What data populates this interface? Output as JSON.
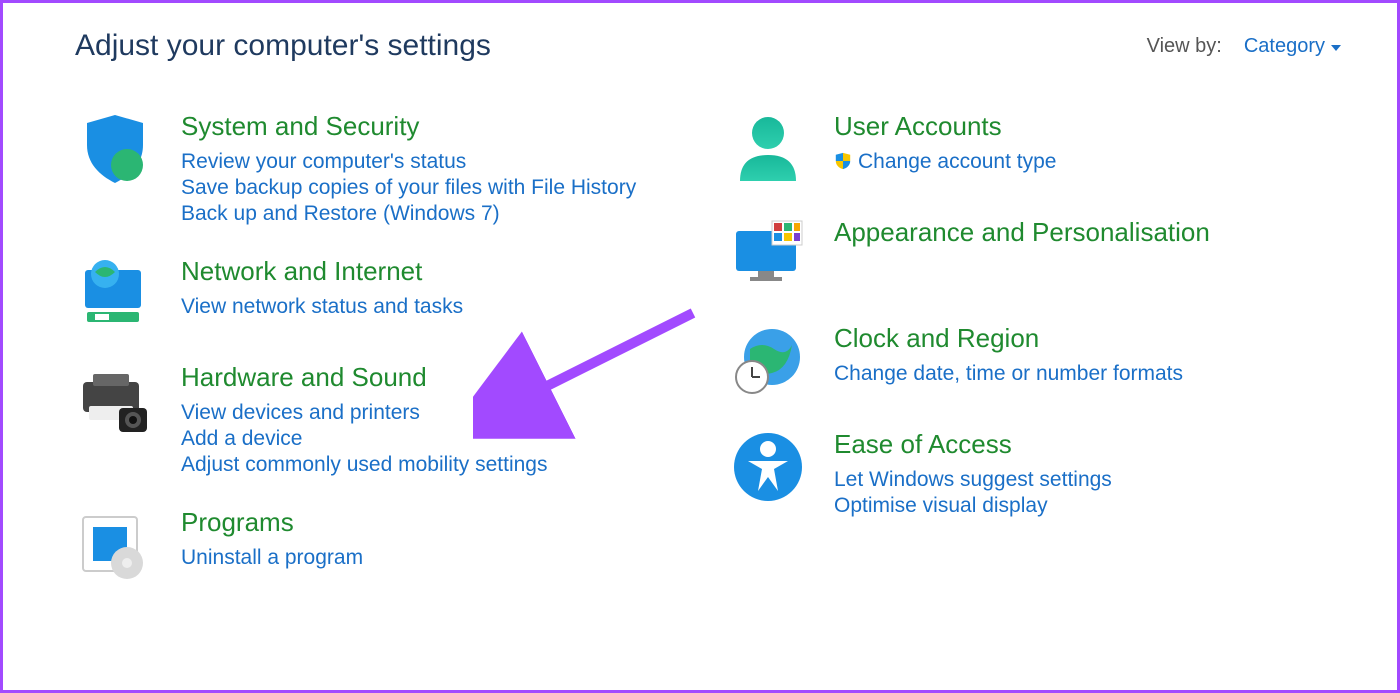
{
  "header": {
    "title": "Adjust your computer's settings",
    "view_by_label": "View by:",
    "view_by_selected": "Category"
  },
  "left_categories": [
    {
      "id": "system-security",
      "title": "System and Security",
      "links": [
        "Review your computer's status",
        "Save backup copies of your files with File History",
        "Back up and Restore (Windows 7)"
      ]
    },
    {
      "id": "network-internet",
      "title": "Network and Internet",
      "links": [
        "View network status and tasks"
      ]
    },
    {
      "id": "hardware-sound",
      "title": "Hardware and Sound",
      "links": [
        "View devices and printers",
        "Add a device",
        "Adjust commonly used mobility settings"
      ]
    },
    {
      "id": "programs",
      "title": "Programs",
      "links": [
        "Uninstall a program"
      ]
    }
  ],
  "right_categories": [
    {
      "id": "user-accounts",
      "title": "User Accounts",
      "links": [
        {
          "text": "Change account type",
          "shield": true
        }
      ]
    },
    {
      "id": "appearance",
      "title": "Appearance and Personalisation",
      "links": []
    },
    {
      "id": "clock-region",
      "title": "Clock and Region",
      "links": [
        "Change date, time or number formats"
      ]
    },
    {
      "id": "ease-access",
      "title": "Ease of Access",
      "links": [
        "Let Windows suggest settings",
        "Optimise visual display"
      ]
    }
  ],
  "annotation": {
    "purpose": "arrow pointing to Hardware and Sound",
    "color": "#a24aff"
  }
}
